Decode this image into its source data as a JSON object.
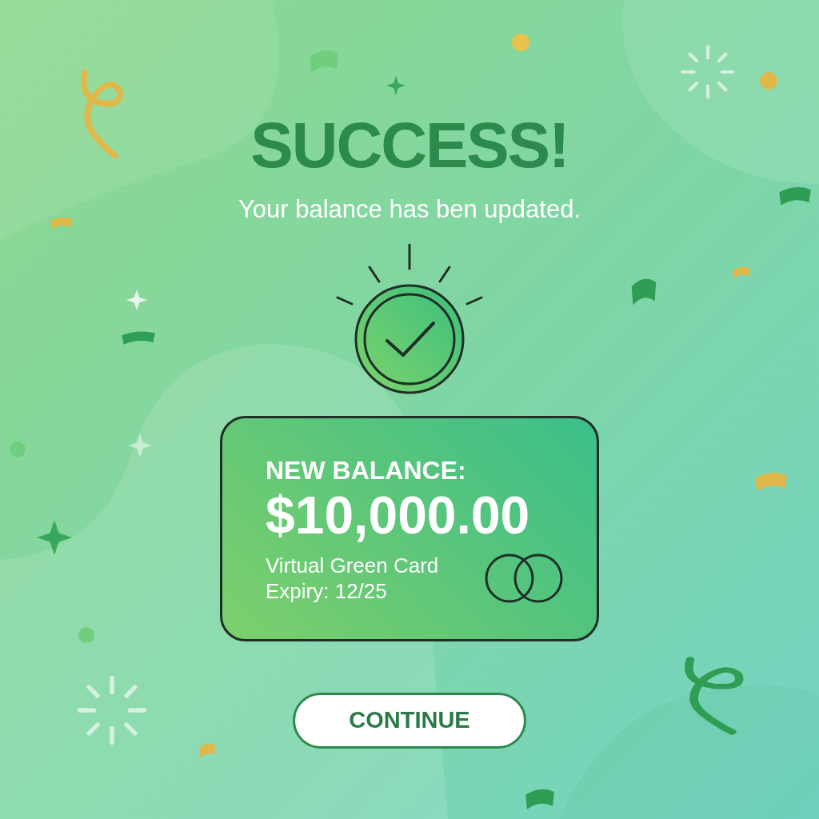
{
  "title": "SUCCESS!",
  "message": "Your balance has ben updated.",
  "card": {
    "label": "NEW BALANCE:",
    "amount": "$10,000.00",
    "name": "Virtual Green Card",
    "expiry": "Expiry: 12/25"
  },
  "button": {
    "label": "CONTINUE"
  }
}
